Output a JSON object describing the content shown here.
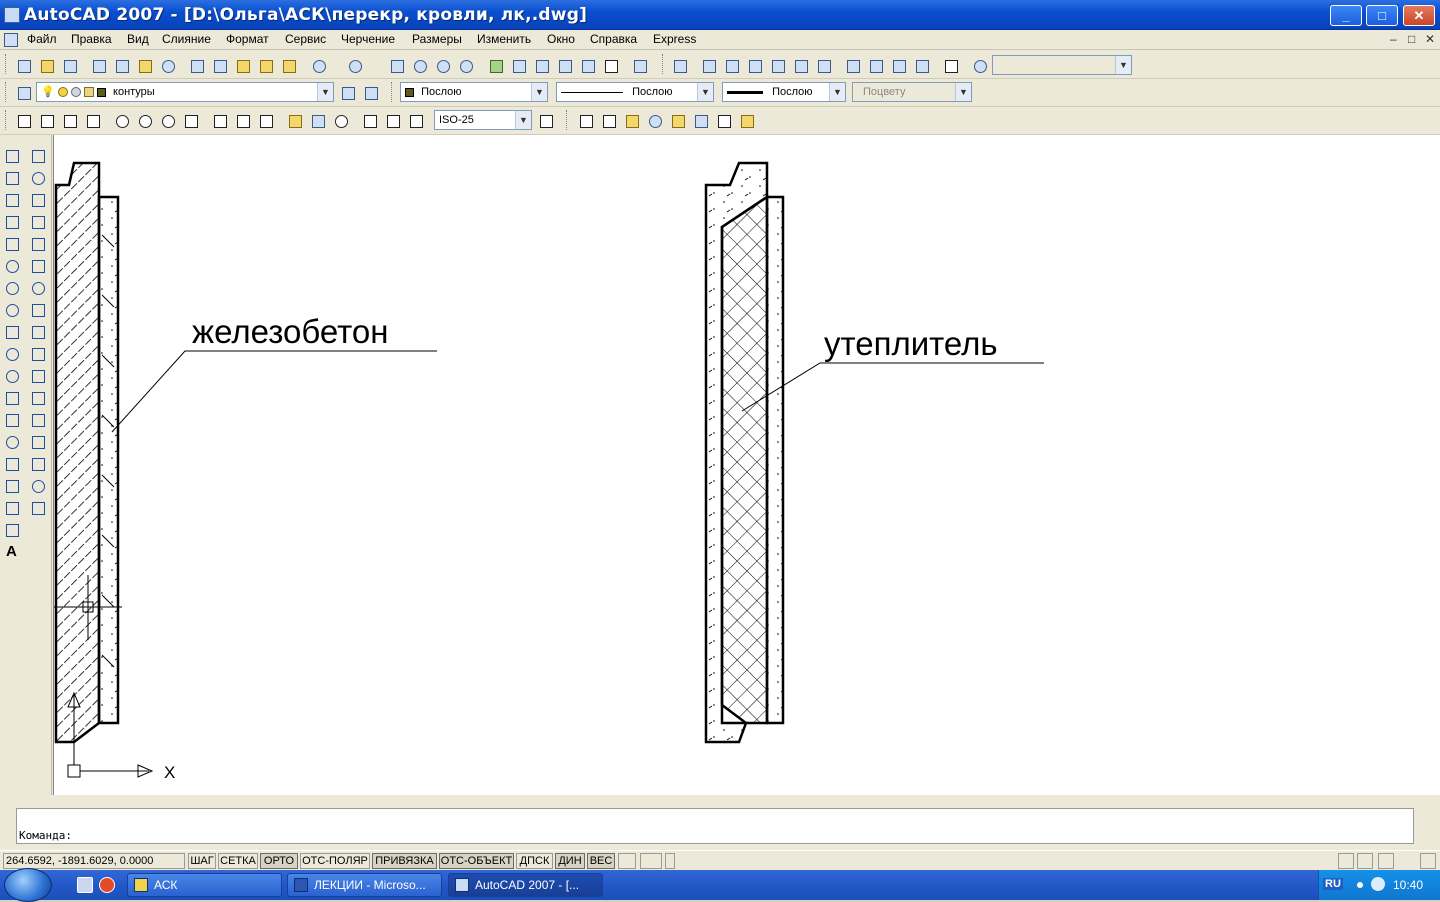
{
  "window": {
    "title": "AutoCAD 2007 - [D:\\Ольга\\АСК\\перекр, кровли, лк,.dwg]",
    "buttons": {
      "minimize": "_",
      "maximize": "□",
      "close": "✕"
    }
  },
  "menu": {
    "items": [
      "Файл",
      "Правка",
      "Вид",
      "Слияние",
      "Формат",
      "Сервис",
      "Черчение",
      "Размеры",
      "Изменить",
      "Окно",
      "Справка",
      "Express"
    ],
    "doc_controls": [
      "–",
      "□",
      "✕"
    ]
  },
  "layers": {
    "current_layer": "контуры",
    "color": "Послою",
    "linetype": "Послою",
    "lineweight": "Послою",
    "plotstyle": "Поцвету"
  },
  "dimstyle": {
    "current": "ISO-25"
  },
  "drawing": {
    "label_left": "железобетон",
    "label_right": "утеплитель",
    "ucs_x": "X"
  },
  "command": {
    "prompt": "Команда:"
  },
  "status": {
    "coords": "264.6592, -1891.6029, 0.0000",
    "toggles": [
      "ШАГ",
      "СЕТКА",
      "ОРТО",
      "ОТС-ПОЛЯР",
      "ПРИВЯЗКА",
      "ОТС-ОБЪЕКТ",
      "ДПСК",
      "ДИН",
      "ВЕС"
    ],
    "toggles_on": [
      "ОРТО",
      "ПРИВЯЗКА",
      "ОТС-ОБЪЕКТ",
      "ДИН",
      "ВЕС"
    ]
  },
  "taskbar": {
    "tasks": [
      "АСК",
      "ЛЕКЦИИ - Microso...",
      "AutoCAD 2007 - [..."
    ],
    "active_task": "AutoCAD 2007 - [...",
    "lang": "RU",
    "clock": "10:40"
  }
}
